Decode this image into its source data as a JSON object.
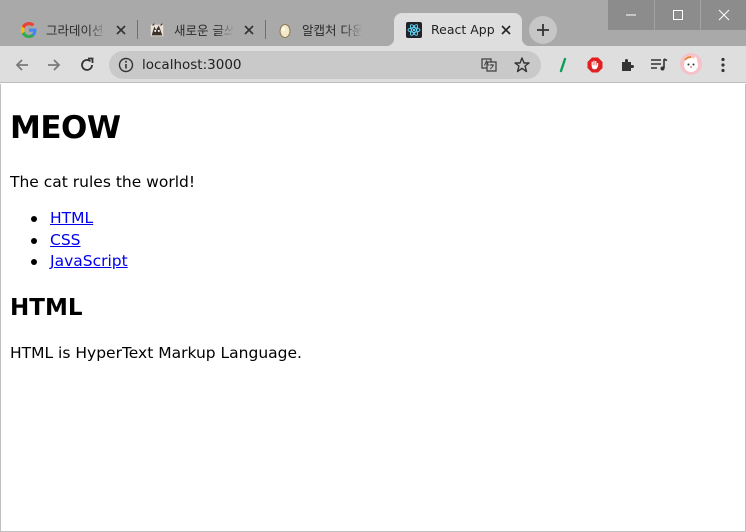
{
  "browser": {
    "tabs": [
      {
        "title": "그라데이션",
        "favicon": "google-favicon-icon",
        "active": false
      },
      {
        "title": "새로운 글쓰",
        "favicon": "cat-favicon-icon",
        "active": false
      },
      {
        "title": "알캡처 다운",
        "favicon": "egg-favicon-icon",
        "active": false
      },
      {
        "title": "React App",
        "favicon": "react-favicon-icon",
        "active": true
      }
    ],
    "url": "localhost:3000"
  },
  "page": {
    "heading": "MEOW",
    "intro": "The cat rules the world!",
    "nav_items": [
      "HTML",
      "CSS",
      "JavaScript"
    ],
    "section_heading": "HTML",
    "section_text": "HTML is HyperText Markup Language."
  },
  "colors": {
    "tabstrip": "#a9a9a9",
    "toolbar": "#dedede",
    "link": "#0000ee"
  }
}
